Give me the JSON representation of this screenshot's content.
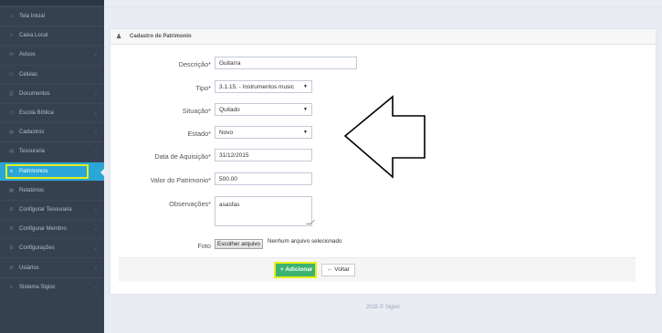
{
  "sidebar": {
    "items": [
      {
        "label": "Tela Inicial",
        "icon": "home-icon",
        "glyph": "⌂",
        "chevron": false
      },
      {
        "label": "Caixa Local",
        "icon": "list-icon",
        "glyph": "≡",
        "chevron": false
      },
      {
        "label": "Avisos",
        "icon": "envelope-icon",
        "glyph": "✉",
        "chevron": true
      },
      {
        "label": "Células",
        "icon": "users-icon",
        "glyph": "⚇",
        "chevron": false
      },
      {
        "label": "Documentos",
        "icon": "document-icon",
        "glyph": "⎙",
        "chevron": true
      },
      {
        "label": "Escola Bíblica",
        "icon": "group-icon",
        "glyph": "⚇",
        "chevron": true
      },
      {
        "label": "Cadastros",
        "icon": "card-icon",
        "glyph": "▤",
        "chevron": true
      },
      {
        "label": "Tesouraria",
        "icon": "money-icon",
        "glyph": "▤",
        "chevron": true
      },
      {
        "label": "Patrimonios",
        "icon": "list-icon",
        "glyph": "≡",
        "chevron": false,
        "active": true
      },
      {
        "label": "Relatórios",
        "icon": "report-icon",
        "glyph": "▦",
        "chevron": false
      },
      {
        "label": "Configurar Tesouraria",
        "icon": "gear-icon",
        "glyph": "⚙",
        "chevron": true
      },
      {
        "label": "Configurar Membro",
        "icon": "gear-icon",
        "glyph": "⚙",
        "chevron": true
      },
      {
        "label": "Configurações",
        "icon": "gear-icon",
        "glyph": "⚙",
        "chevron": true
      },
      {
        "label": "Usiários",
        "icon": "gear-icon",
        "glyph": "⚙",
        "chevron": true
      },
      {
        "label": "Sistema Sigioc",
        "icon": "list-icon",
        "glyph": "≡",
        "chevron": true
      }
    ]
  },
  "portlet": {
    "title": "Cadastro de Patrimonio"
  },
  "form": {
    "descricao": {
      "label": "Descrição*",
      "value": "Guitarra"
    },
    "tipo": {
      "label": "Tipo*",
      "value": "3.1.15. - Instrumentos music"
    },
    "situacao": {
      "label": "Situação*",
      "value": "Quitado"
    },
    "estado": {
      "label": "Estado*",
      "value": "Novo"
    },
    "data_aquisicao": {
      "label": "Data de Aquisição*",
      "value": "31/12/2015"
    },
    "valor": {
      "label": "Valor do Patrimonio*",
      "value": "500.00"
    },
    "observacoes": {
      "label": "Observações*",
      "value": "asasfas"
    },
    "foto": {
      "label": "Foto",
      "button": "Escolher arquivo",
      "status": "Nenhum arquivo selecionado"
    }
  },
  "actions": {
    "add": "+ Adicionar",
    "back": "← Voltar"
  },
  "footer": {
    "text": "2015 © Sigioc"
  },
  "colors": {
    "sidebar_bg": "#364150",
    "active_item": "#2aa7d6",
    "highlight": "#e7ef1a",
    "add_button": "#3cb371"
  },
  "icons": {
    "caret": "▼",
    "user": "♟"
  }
}
